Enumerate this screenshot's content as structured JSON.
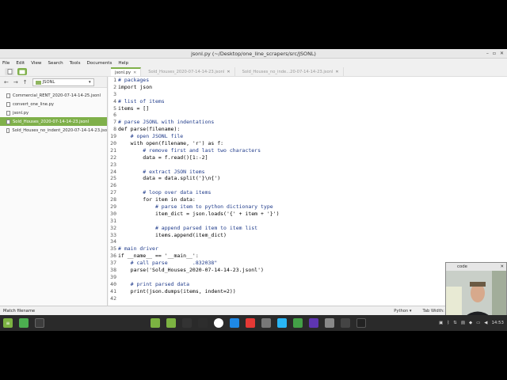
{
  "window": {
    "title": "jsonl.py (~/Desktop/one_line_scrapers/src/JSONL)",
    "controls": [
      "–",
      "▫",
      "✕"
    ]
  },
  "menu": [
    "File",
    "Edit",
    "View",
    "Search",
    "Tools",
    "Documents",
    "Help"
  ],
  "tabs": [
    {
      "label": "jsonl.py",
      "active": true
    },
    {
      "label": "Sold_Houses_2020-07-14-14-23.jsonl",
      "active": false
    },
    {
      "label": "Sold_Houses_no_inde...20-07-14-14-23.jsonl",
      "active": false
    }
  ],
  "sidebar": {
    "folder": "JSONL",
    "files": [
      {
        "name": "Commercial_RENT_2020-07-14-14-25.jsonl",
        "selected": false
      },
      {
        "name": "convert_one_line.py",
        "selected": false
      },
      {
        "name": "jsonl.py",
        "selected": false
      },
      {
        "name": "Sold_Houses_2020-07-14-14-23.jsonl",
        "selected": true
      },
      {
        "name": "Sold_Houses_no_indent_2020-07-14-14-23.jso",
        "selected": false
      }
    ]
  },
  "code_lines": [
    {
      "n": "1",
      "text": "# packages",
      "cls": "cmt"
    },
    {
      "n": "2",
      "text": "import json",
      "cls": "code"
    },
    {
      "n": "3",
      "text": "",
      "cls": "code"
    },
    {
      "n": "4",
      "text": "# list of items",
      "cls": "cmt"
    },
    {
      "n": "5",
      "text": "items = []",
      "cls": "code"
    },
    {
      "n": "6",
      "text": "",
      "cls": "code"
    },
    {
      "n": "7",
      "text": "# parse JSONL with indentations",
      "cls": "cmt"
    },
    {
      "n": "8",
      "text": "def parse(filename):",
      "cls": "code"
    },
    {
      "n": "19",
      "text": "    # open JSONL file",
      "cls": "cmt"
    },
    {
      "n": "20",
      "text": "    with open(filename, 'r') as f:",
      "cls": "code"
    },
    {
      "n": "21",
      "text": "        # remove first and last two characters",
      "cls": "cmt"
    },
    {
      "n": "22",
      "text": "        data = f.read()[1:-2]",
      "cls": "code"
    },
    {
      "n": "23",
      "text": "",
      "cls": "code"
    },
    {
      "n": "24",
      "text": "        # extract JSON items",
      "cls": "cmt"
    },
    {
      "n": "25",
      "text": "        data = data.split('}\\n{')",
      "cls": "code"
    },
    {
      "n": "26",
      "text": "",
      "cls": "code"
    },
    {
      "n": "27",
      "text": "        # loop over data items",
      "cls": "cmt"
    },
    {
      "n": "28",
      "text": "        for item in data:",
      "cls": "code"
    },
    {
      "n": "29",
      "text": "            # parse item to python dictionary type",
      "cls": "cmt"
    },
    {
      "n": "30",
      "text": "            item_dict = json.loads('{' + item + '}')",
      "cls": "code"
    },
    {
      "n": "31",
      "text": "",
      "cls": "code"
    },
    {
      "n": "32",
      "text": "            # append parsed item to item list",
      "cls": "cmt"
    },
    {
      "n": "33",
      "text": "            items.append(item_dict)",
      "cls": "code"
    },
    {
      "n": "34",
      "text": "",
      "cls": "code"
    },
    {
      "n": "35",
      "text": "# main driver",
      "cls": "cmt"
    },
    {
      "n": "36",
      "text": "if __name__ == '__main__':",
      "cls": "code"
    },
    {
      "n": "37",
      "text": "    # call parse        .832038\"",
      "cls": "cmt"
    },
    {
      "n": "38",
      "text": "    parse('Sold_Houses_2020-07-14-14-23.jsonl')",
      "cls": "code"
    },
    {
      "n": "39",
      "text": "",
      "cls": "code"
    },
    {
      "n": "40",
      "text": "    # print parsed data",
      "cls": "cmt"
    },
    {
      "n": "41",
      "text": "    print(json.dumps(items, indent=2))",
      "cls": "code"
    },
    {
      "n": "42",
      "text": "",
      "cls": "code"
    }
  ],
  "status": {
    "left": "Match filename",
    "language": "Python",
    "tab_width": "Tab Width: 4"
  },
  "webcam": {
    "title": "code"
  },
  "taskbar": {
    "clock": "14:53"
  }
}
